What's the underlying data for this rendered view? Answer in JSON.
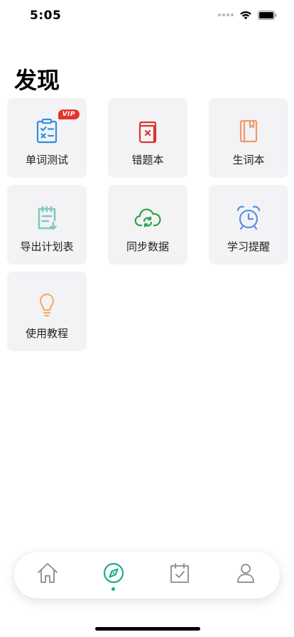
{
  "status_bar": {
    "time": "5:05"
  },
  "page": {
    "title": "发现"
  },
  "tiles": [
    {
      "label": "单词测试",
      "icon": "quiz-clipboard-icon",
      "color": "#2e8fe0",
      "badge": "VIP"
    },
    {
      "label": "错题本",
      "icon": "wrong-book-icon",
      "color": "#d9362b"
    },
    {
      "label": "生词本",
      "icon": "vocab-book-icon",
      "color": "#ee9a6a"
    },
    {
      "label": "导出计划表",
      "icon": "export-plan-icon",
      "color": "#7ec9c0"
    },
    {
      "label": "同步数据",
      "icon": "cloud-sync-icon",
      "color": "#2aa347"
    },
    {
      "label": "学习提醒",
      "icon": "alarm-clock-icon",
      "color": "#5a8fe8"
    },
    {
      "label": "使用教程",
      "icon": "lightbulb-icon",
      "color": "#f2b06a"
    }
  ],
  "tab_bar": {
    "tabs": [
      {
        "name": "home",
        "icon": "home-icon",
        "active": false
      },
      {
        "name": "discover",
        "icon": "compass-icon",
        "active": true
      },
      {
        "name": "checkin",
        "icon": "calendar-check-icon",
        "active": false
      },
      {
        "name": "profile",
        "icon": "person-icon",
        "active": false
      }
    ],
    "active_color": "#1fae8e",
    "inactive_color": "#8a8a8a"
  }
}
